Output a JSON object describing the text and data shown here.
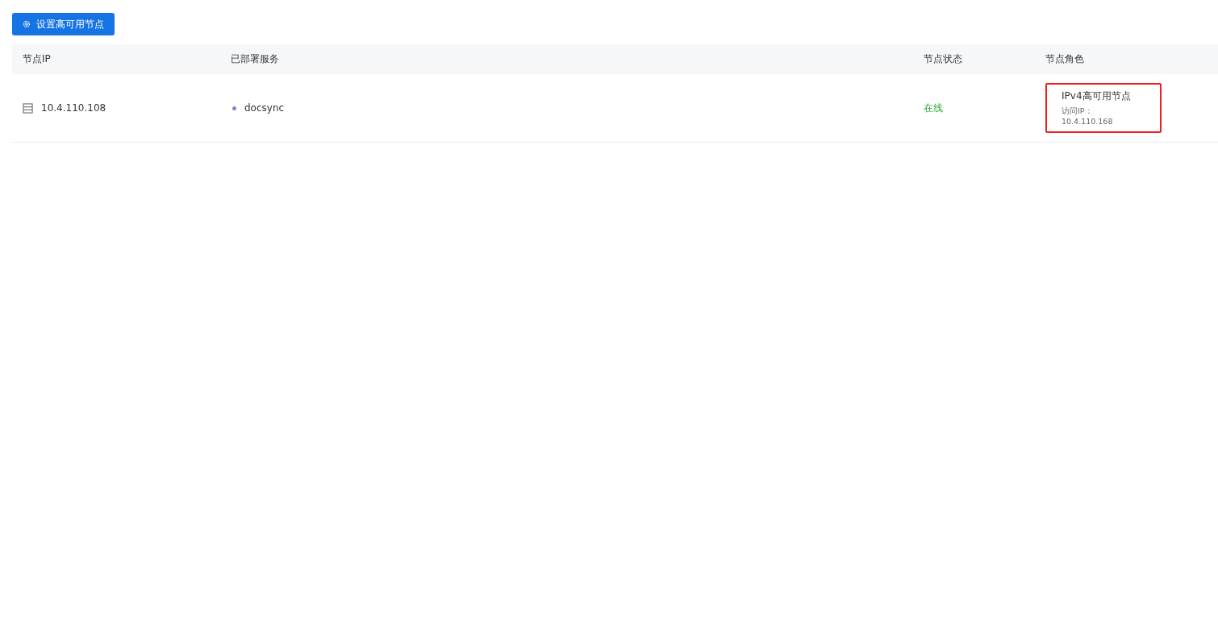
{
  "toolbar": {
    "button": "设置高可用节点"
  },
  "table": {
    "columns": [
      "节点IP",
      "已部署服务",
      "节点状态",
      "节点角色"
    ],
    "rows": [
      {
        "ip": "10.4.110.108",
        "services": [
          {
            "name": "docsync",
            "color": "#8c7fd0"
          }
        ],
        "status": {
          "text": "在线",
          "kind": "online"
        },
        "role": {
          "title": "IPv4高可用节点",
          "label": "访问IP：",
          "ip": "10.4.110.168",
          "highlighted": true
        }
      }
    ]
  }
}
